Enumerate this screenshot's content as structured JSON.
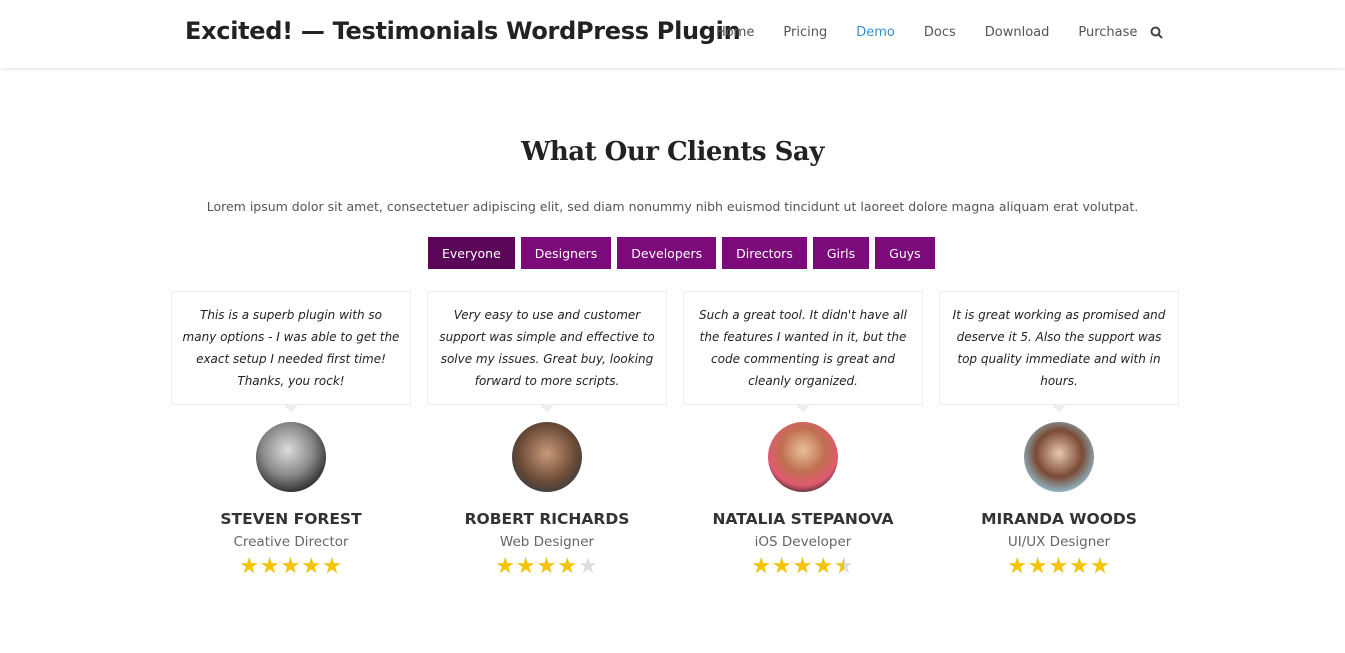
{
  "header": {
    "title": "Excited! — Testimonials WordPress Plugin",
    "nav": [
      "Home",
      "Pricing",
      "Demo",
      "Docs",
      "Download",
      "Purchase"
    ],
    "active": "Demo"
  },
  "section": {
    "title": "What Our Clients Say",
    "lead": "Lorem ipsum dolor sit amet, consectetuer adipiscing elit, sed diam nonummy nibh euismod tincidunt ut laoreet dolore magna aliquam erat volutpat."
  },
  "filters": [
    "Everyone",
    "Designers",
    "Developers",
    "Directors",
    "Girls",
    "Guys"
  ],
  "colors": {
    "accent": "#7d0a7a",
    "active": "#5c065a",
    "star": "#f5c400",
    "link": "#3a8fc0"
  },
  "testimonials": [
    {
      "quote": "This is a superb plugin with so many options - I was able to get the exact setup I needed first time! Thanks, you rock!",
      "name": "STEVEN FOREST",
      "role": "Creative Director",
      "rating": 5
    },
    {
      "quote": "Very easy to use and customer support was simple and effective to solve my issues. Great buy, looking forward to more scripts.",
      "name": "ROBERT RICHARDS",
      "role": "Web Designer",
      "rating": 4
    },
    {
      "quote": "Such a great tool. It didn't have all the features I wanted in it, but the code commenting is great and cleanly organized.",
      "name": "NATALIA STEPANOVA",
      "role": "iOS Developer",
      "rating": 4.5
    },
    {
      "quote": "It is great working as promised and deserve it 5. Also the support was top quality immediate and with in hours.",
      "name": "MIRANDA WOODS",
      "role": "UI/UX Designer",
      "rating": 5
    }
  ]
}
